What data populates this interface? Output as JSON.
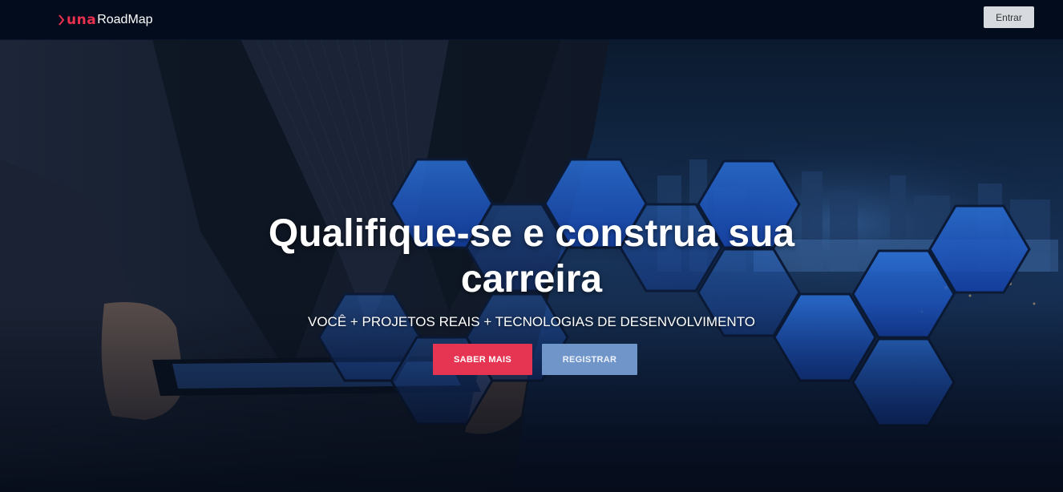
{
  "navbar": {
    "brand_una": "una",
    "brand_roadmap": "RoadMap",
    "login_label": "Entrar"
  },
  "hero": {
    "title": "Qualifique-se e construa sua carreira",
    "subtitle": "VOCÊ + PROJETOS REAIS + TECNOLOGIAS DE DESENVOLVIMENTO",
    "saber_mais_label": "SABER MAIS",
    "registrar_label": "REGISTRAR"
  },
  "colors": {
    "navbar_bg": "#030c1d",
    "brand_accent": "#e8304f",
    "primary_button": "#e53552",
    "secondary_button": "#6f95c9",
    "login_button": "#d7dbe0"
  },
  "icons": {
    "brand_logo": "una-logo-icon"
  }
}
